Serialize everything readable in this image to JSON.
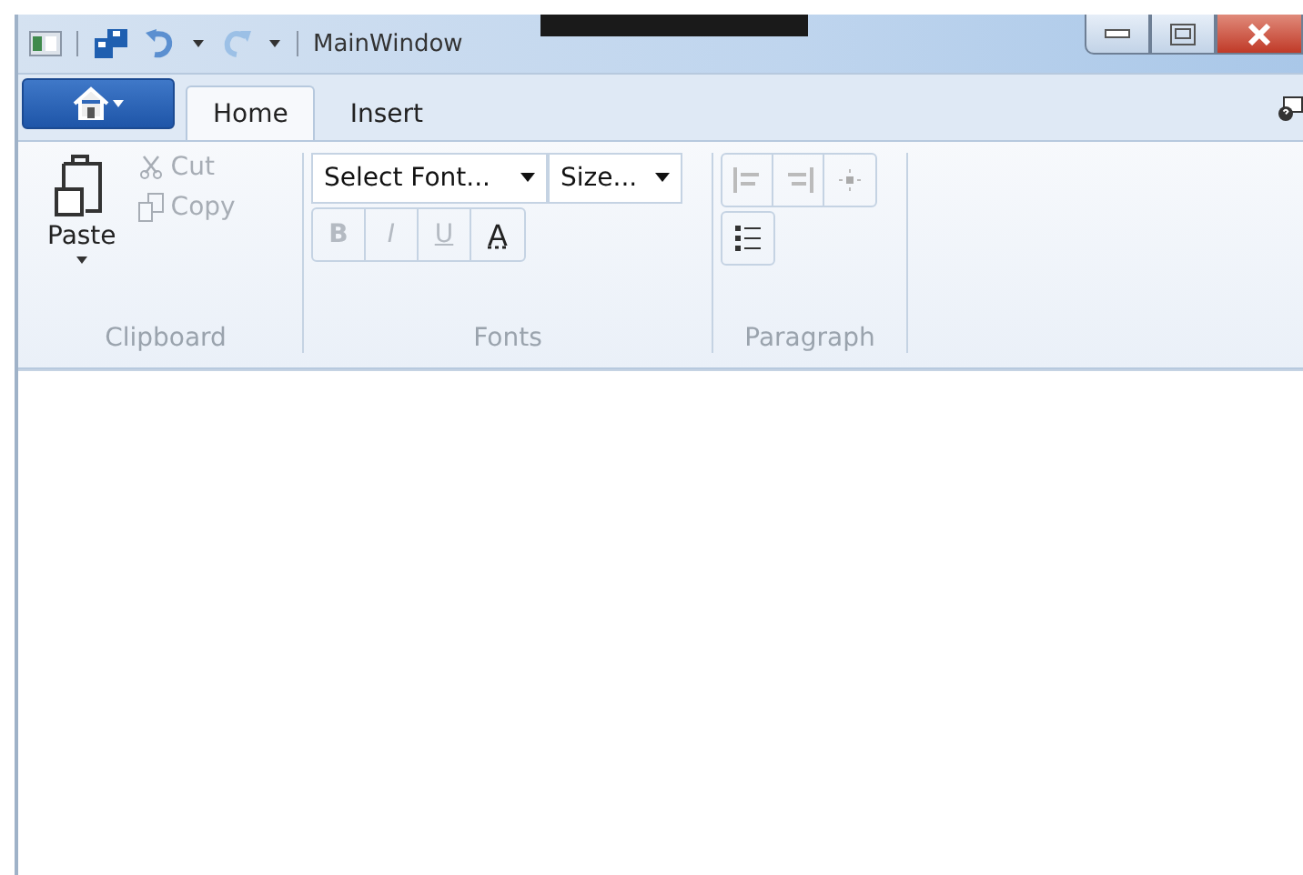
{
  "window": {
    "title": "MainWindow"
  },
  "tabs": [
    {
      "label": "Home",
      "selected": true
    },
    {
      "label": "Insert",
      "selected": false
    }
  ],
  "clipboard": {
    "label": "Clipboard",
    "paste": "Paste",
    "items": [
      {
        "kind": "cut",
        "label": "Cut",
        "disabled": true
      },
      {
        "kind": "copy",
        "label": "Copy",
        "disabled": true
      }
    ]
  },
  "fonts": {
    "label": "Fonts",
    "font_box": {
      "value": "Select Font..."
    },
    "size_box": {
      "value": "Size..."
    },
    "format_buttons": [
      {
        "label": "B",
        "disabled": true
      },
      {
        "label": "I",
        "disabled": true
      },
      {
        "label": "U",
        "disabled": true
      },
      {
        "label": "A",
        "disabled": false
      }
    ]
  },
  "paragraph": {
    "label": "Paragraph"
  }
}
